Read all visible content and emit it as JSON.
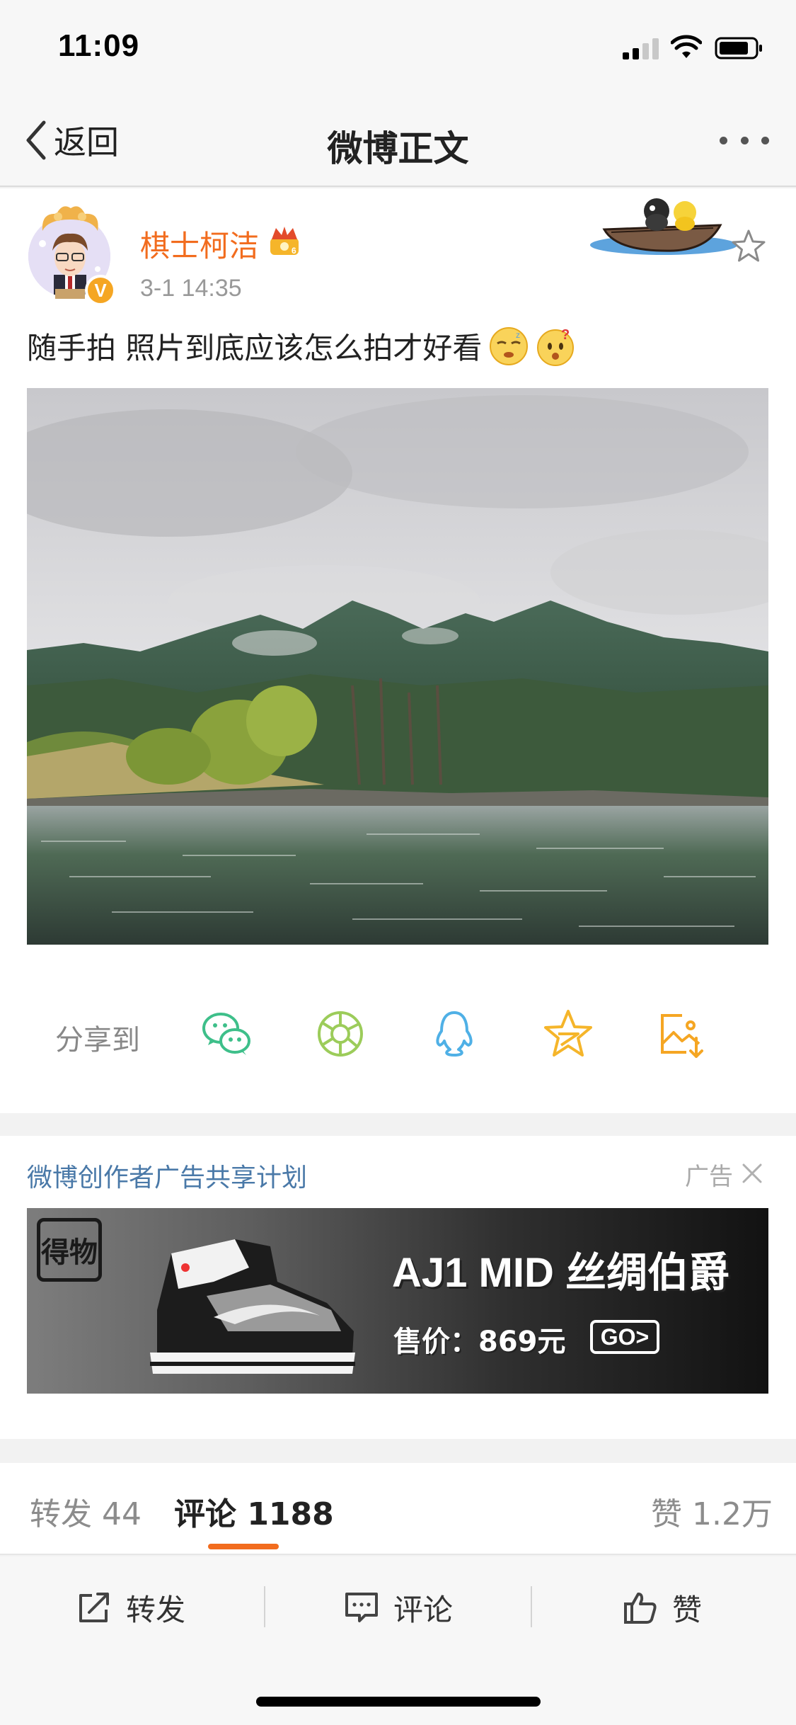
{
  "status_bar": {
    "time": "11:09"
  },
  "nav": {
    "back_label": "返回",
    "title": "微博正文"
  },
  "post": {
    "author": "棋士柯洁",
    "verified_badge": "V",
    "time": "3-1 14:35",
    "text": "随手拍 照片到底应该怎么拍才好看",
    "share_label": "分享到",
    "share_targets": [
      "wechat-icon",
      "moments-icon",
      "qq-icon",
      "qzone-icon",
      "save-image-icon"
    ]
  },
  "ad": {
    "program_title": "微博创作者广告共享计划",
    "tag": "广告",
    "brand": "得物",
    "headline": "AJ1 MID 丝绸伯爵",
    "price": "售价：869元",
    "cta": "GO>"
  },
  "tabs": {
    "repost": "转发 44",
    "comments": "评论 1188",
    "likes": "赞 1.2万"
  },
  "toolbar": {
    "repost": "转发",
    "comment": "评论",
    "like": "赞"
  },
  "colors": {
    "accent": "#f26c1e",
    "link_blue": "#4a79a8",
    "background": "#f2f2f2"
  }
}
